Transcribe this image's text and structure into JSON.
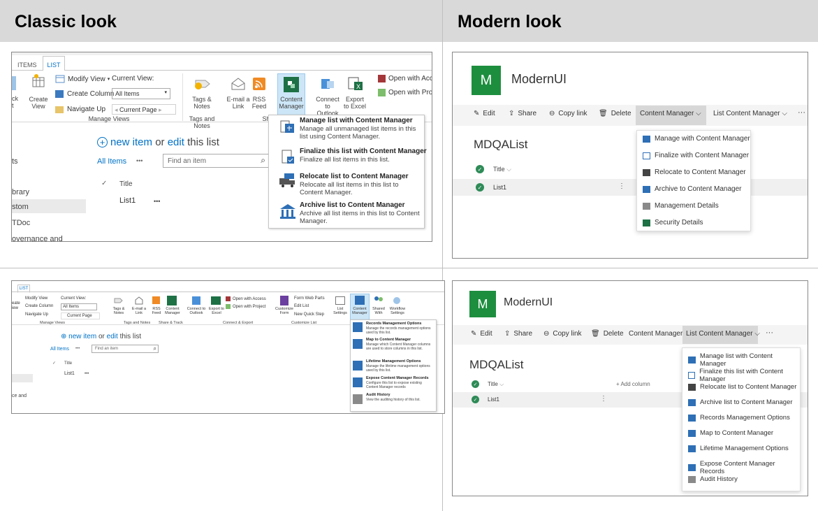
{
  "headers": {
    "classic": "Classic look",
    "modern": "Modern look"
  },
  "classic_top": {
    "tabs": [
      "ITEMS",
      "LIST"
    ],
    "ribbon": {
      "modify_view": "Modify View",
      "current_view": "Current View:",
      "create_column": "Create Column",
      "all_items_select": "All Items",
      "navigate_up": "Navigate Up",
      "current_page": "Current Page",
      "create_view": "Create View",
      "left_frag": "ck",
      "left_frag2": "t",
      "tags_notes": "Tags & Notes",
      "email": "E-mail a Link",
      "rss": "RSS Feed",
      "content_manager": "Content Manager",
      "connect_outlook": "Connect to Outlook",
      "export_excel": "Export to Excel",
      "open_access": "Open with Acce",
      "open_project": "Open with Proj",
      "grp_manage": "Manage Views",
      "grp_tags": "Tags and Notes",
      "grp_share": "Share & Tr"
    },
    "list": {
      "new_item": "new item",
      "or": "or",
      "edit": "edit",
      "this_list": "this list",
      "all_items": "All Items",
      "ellipsis": "•••",
      "find": "Find an item",
      "title_col": "Title",
      "row1": "List1",
      "row_dots": "•••"
    },
    "nav": [
      "ts",
      "brary",
      "stom",
      "TDoc",
      "overnance and"
    ],
    "menu": [
      {
        "title": "Manage list with Content Manager",
        "desc": "Manage all unmanaged list items in this list using Content Manager."
      },
      {
        "title": "Finalize this list with Content Manager",
        "desc": "Finalize all list items in this list."
      },
      {
        "title": "Relocate list to Content Manager",
        "desc": "Relocate all list items in this list to Content Manager."
      },
      {
        "title": "Archive list to Content Manager",
        "desc": "Archive all list items in this list to Content Manager."
      }
    ]
  },
  "classic_bottom": {
    "tab": "LIST",
    "ribbon": {
      "modify_view": "Modify View",
      "current_view": "Current View:",
      "create_column": "Create Column",
      "all_items": "All Items",
      "navigate_up": "Navigate Up",
      "current_page": "Current Page",
      "left1": "eate",
      "left2": "iew",
      "tags": "Tags & Notes",
      "email": "E-mail a Link",
      "rss": "RSS Feed",
      "cm": "Content Manager",
      "outlook": "Connect to Outlook",
      "excel": "Export to Excel",
      "access": "Open with Access",
      "project": "Open with Project",
      "customize": "Customize Form",
      "form_web_parts": "Form Web Parts",
      "edit_list": "Edit List",
      "quick_step": "New Quick Step",
      "list_settings": "List Settings",
      "cm2": "Content Manager",
      "shared": "Shared With",
      "workflow": "Workflow Settings",
      "g1": "Manage Views",
      "g2": "Tags and Notes",
      "g3": "Share & Track",
      "g4": "Connect & Export",
      "g5": "Customize List"
    },
    "list": {
      "new_item": "new item",
      "or": "or",
      "edit": "edit",
      "this_list": "this list",
      "all_items": "All Items",
      "dots": "•••",
      "find": "Find an item",
      "title": "Title",
      "row": "List1",
      "row_dots": "•••"
    },
    "nav": "ce and",
    "menu": [
      {
        "title": "Records Management Options",
        "desc": "Manage the records management options used by this list."
      },
      {
        "title": "Map to Content Manager",
        "desc": "Manage which Content Manager columns are used to store columns in this list."
      },
      {
        "title": "Lifetime Management Options",
        "desc": "Manage the lifetime management options used by this list."
      },
      {
        "title": "Expose Content Manager Records",
        "desc": "Configure this list to expose existing Content Manager records"
      },
      {
        "title": "Audit History",
        "desc": "View the auditing history of this list."
      }
    ]
  },
  "modern_top": {
    "logo_letter": "M",
    "site": "ModernUI",
    "cmd": {
      "edit": "Edit",
      "share": "Share",
      "copy": "Copy link",
      "delete": "Delete",
      "cm": "Content Manager",
      "lcm": "List Content Manager",
      "more": "···"
    },
    "list_title": "MDQAList",
    "title_col": "Title",
    "row": "List1",
    "row_dots": "⋮",
    "menu": [
      "Manage with Content Manager",
      "Finalize with Content Manager",
      "Relocate to Content Manager",
      "Archive to Content Manager",
      "Management Details",
      "Security Details"
    ]
  },
  "modern_bottom": {
    "logo_letter": "M",
    "site": "ModernUI",
    "cmd": {
      "edit": "Edit",
      "share": "Share",
      "copy": "Copy link",
      "delete": "Delete",
      "cm": "Content Manager",
      "lcm": "List Content Manager",
      "more": "···"
    },
    "list_title": "MDQAList",
    "title_col": "Title",
    "add_col": "+ Add column",
    "row": "List1",
    "row_dots": "⋮",
    "menu": [
      "Manage list with Content Manager",
      "Finalize this list with Content Manager",
      "Relocate list to Content Manager",
      "Archive list to Content Manager",
      "Records Management Options",
      "Map to Content Manager",
      "Lifetime Management Options",
      "Expose Content Manager Records",
      "Audit History"
    ]
  },
  "colors": {
    "header_bg": "#d9d9d9",
    "accent": "#0072c6",
    "logo": "#1d8e3e",
    "check": "#2e8b57"
  }
}
